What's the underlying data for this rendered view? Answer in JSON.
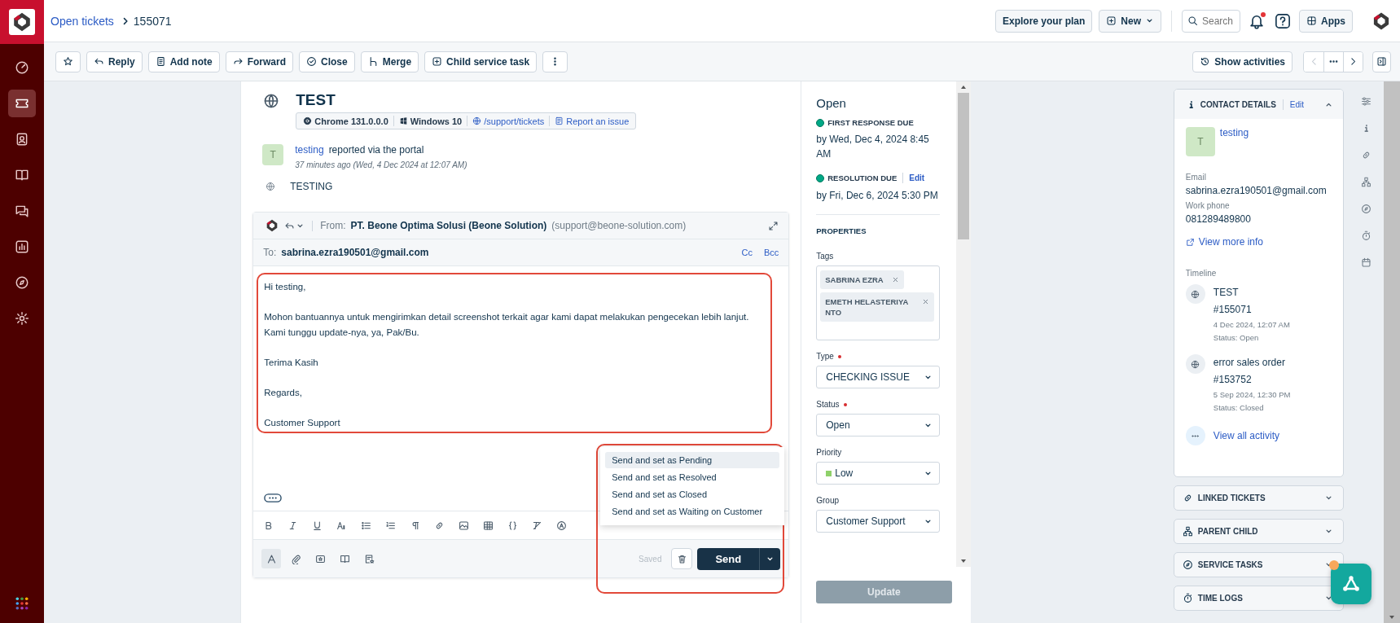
{
  "breadcrumb": {
    "parent": "Open tickets",
    "current": "155071"
  },
  "header_actions": {
    "plan": "Explore your plan",
    "new": "New",
    "search_placeholder": "Search",
    "notifications_unread": true,
    "apps": "Apps"
  },
  "sidebar": [
    {
      "kind": "gauge",
      "selected": false
    },
    {
      "kind": "ticket",
      "selected": true
    },
    {
      "kind": "contact",
      "selected": false
    },
    {
      "kind": "book",
      "selected": false
    },
    {
      "kind": "chat",
      "selected": false
    },
    {
      "kind": "chart",
      "selected": false
    },
    {
      "kind": "compass",
      "selected": false
    },
    {
      "kind": "gear",
      "selected": false
    }
  ],
  "toolbar": [
    {
      "kind": "star"
    },
    {
      "kind": "reply",
      "label": "Reply"
    },
    {
      "kind": "note",
      "label": "Add note"
    },
    {
      "kind": "forward",
      "label": "Forward"
    },
    {
      "kind": "check",
      "label": "Close"
    },
    {
      "kind": "merge",
      "label": "Merge"
    },
    {
      "kind": "child",
      "label": "Child service task"
    },
    {
      "kind": "more"
    }
  ],
  "activities": "Show activities",
  "ticket": {
    "title": "TEST",
    "meta": [
      {
        "kind": "browser",
        "text": "Chrome 131.0.0.0",
        "link": false
      },
      {
        "kind": "windows",
        "text": "Windows 10",
        "link": false
      },
      {
        "kind": "globe",
        "text": "/support/tickets",
        "link": true
      },
      {
        "kind": "report",
        "text": "Report an issue",
        "link": true
      }
    ],
    "reporter": {
      "avatar": "T",
      "name": "testing",
      "action": "reported via the portal",
      "time": "37 minutes ago (Wed, 4 Dec 2024 at 12:07 AM)"
    },
    "description": "TESTING"
  },
  "reply": {
    "from_label": "From:",
    "from_name": "PT. Beone Optima Solusi (Beone Solution)",
    "from_email": "(support@beone-solution.com)",
    "to_label": "To:",
    "to": "sabrina.ezra190501@gmail.com",
    "cc": "Cc",
    "bcc": "Bcc",
    "body": [
      {
        "lines": [
          "Hi testing,"
        ]
      },
      {
        "lines": [
          "Mohon bantuannya untuk mengirimkan detail screenshot terkait agar kami dapat melakukan pengecekan lebih lanjut.",
          "Kami tunggu update-nya, ya, Pak/Bu."
        ]
      },
      {
        "lines": [
          "Terima Kasih"
        ]
      },
      {
        "lines": [
          "Regards,"
        ]
      },
      {
        "lines": [
          "Customer Support"
        ]
      }
    ],
    "send_menu": [
      {
        "label": "Send and set as Pending",
        "selected": true
      },
      {
        "label": "Send and set as Resolved",
        "selected": false
      },
      {
        "label": "Send and set as Closed",
        "selected": false
      },
      {
        "label": "Send and set as Waiting on Customer",
        "selected": false
      }
    ],
    "saved": "Saved",
    "send": "Send"
  },
  "properties": {
    "status": "Open",
    "sla": [
      {
        "label": "FIRST RESPONSE DUE",
        "date": "by Wed, Dec 4, 2024 8:45 AM"
      },
      {
        "label": "RESOLUTION DUE",
        "date": "by Fri, Dec 6, 2024 5:30 PM",
        "edit": "Edit"
      }
    ],
    "heading": "PROPERTIES",
    "tags_label": "Tags",
    "tags": [
      "SABRINA EZRA",
      "EMETH HELASTERIYA NTO"
    ],
    "fields": [
      {
        "label": "Type",
        "required": true,
        "value": "CHECKING ISSUE"
      },
      {
        "label": "Status",
        "required": true,
        "value": "Open"
      },
      {
        "label": "Priority",
        "required": false,
        "value": "Low",
        "color": "#8fd16a"
      },
      {
        "label": "Group",
        "required": false,
        "value": "Customer Support"
      }
    ],
    "update": {
      "label": "Update",
      "disabled": true
    }
  },
  "contact": {
    "heading": "CONTACT DETAILS",
    "edit": "Edit",
    "expanded": true,
    "avatar": "T",
    "name": "testing",
    "email_label": "Email",
    "email": "sabrina.ezra190501@gmail.com",
    "phone_label": "Work phone",
    "phone": "081289489800",
    "view_more": "View more info",
    "timeline_label": "Timeline",
    "timeline": [
      {
        "title": "TEST",
        "id": "#155071",
        "date": "4 Dec 2024, 12:07 AM",
        "status": "Status: Open"
      },
      {
        "title": "error sales order",
        "id": "#153752",
        "date": "5 Sep 2024, 12:30 PM",
        "status": "Status: Closed"
      }
    ],
    "view_all": "View all activity"
  },
  "sections": [
    {
      "kind": "link",
      "label": "LINKED TICKETS",
      "expanded": false
    },
    {
      "kind": "hierarchy",
      "label": "PARENT CHILD",
      "expanded": false
    },
    {
      "kind": "compass",
      "label": "SERVICE TASKS",
      "expanded": false
    },
    {
      "kind": "stopwatch",
      "label": "TIME LOGS",
      "expanded": false
    }
  ],
  "side_icons": [
    {
      "kind": "sliders"
    },
    {
      "kind": "info"
    },
    {
      "kind": "link"
    },
    {
      "kind": "hierarchy"
    },
    {
      "kind": "compass"
    },
    {
      "kind": "stopwatch"
    },
    {
      "kind": "calendar"
    }
  ],
  "assistant": {
    "unread": true
  }
}
